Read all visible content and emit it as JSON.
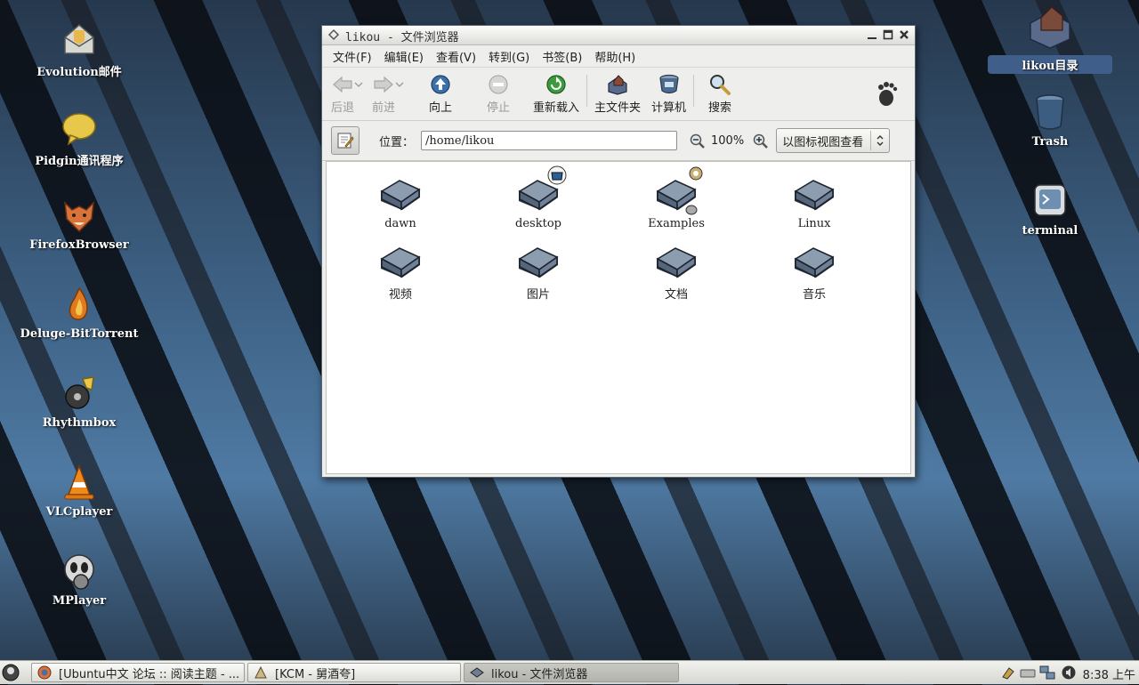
{
  "desktop": {
    "left_icons": [
      {
        "label": "Evolution邮件",
        "icon": "mail-icon"
      },
      {
        "label": "Pidgin通讯程序",
        "icon": "chat-icon"
      },
      {
        "label": "FirefoxBrowser",
        "icon": "firefox-icon"
      },
      {
        "label": "Deluge-BitTorrent",
        "icon": "torrent-icon"
      },
      {
        "label": "Rhythmbox",
        "icon": "music-icon"
      },
      {
        "label": "VLCplayer",
        "icon": "vlc-icon"
      },
      {
        "label": "MPlayer",
        "icon": "mplayer-icon"
      }
    ],
    "right_icons": [
      {
        "label": "likou目录",
        "icon": "home-folder-icon",
        "selected": true
      },
      {
        "label": "Trash",
        "icon": "trash-icon"
      },
      {
        "label": "terminal",
        "icon": "terminal-icon"
      }
    ]
  },
  "window": {
    "title": "likou - 文件浏览器",
    "menu": [
      "文件(F)",
      "编辑(E)",
      "查看(V)",
      "转到(G)",
      "书签(B)",
      "帮助(H)"
    ],
    "toolbar": {
      "back": "后退",
      "forward": "前进",
      "up": "向上",
      "stop": "停止",
      "reload": "重新载入",
      "home": "主文件夹",
      "computer": "计算机",
      "search": "搜索"
    },
    "location": {
      "label": "位置：",
      "value": "/home/likou",
      "zoom": "100%",
      "view_mode": "以图标视图查看"
    },
    "files": [
      {
        "name": "dawn",
        "emblem": null
      },
      {
        "name": "desktop",
        "emblem": "desktop-emblem"
      },
      {
        "name": "Examples",
        "emblem": "link-emblem"
      },
      {
        "name": "Linux",
        "emblem": null
      },
      {
        "name": "视频",
        "emblem": null
      },
      {
        "name": "图片",
        "emblem": null
      },
      {
        "name": "文档",
        "emblem": null
      },
      {
        "name": "音乐",
        "emblem": null
      }
    ]
  },
  "taskbar": {
    "tasks": [
      {
        "label": "[Ubuntu中文 论坛 :: 阅读主题 - ...",
        "active": false
      },
      {
        "label": "[KCM - 舅酒夸]",
        "active": false
      },
      {
        "label": "likou - 文件浏览器",
        "active": true
      }
    ],
    "clock": "8:38 上午"
  },
  "colors": {
    "folder": "#6f7f93",
    "window_bg": "#eeeeec",
    "active_task": "#b3b3ae"
  }
}
